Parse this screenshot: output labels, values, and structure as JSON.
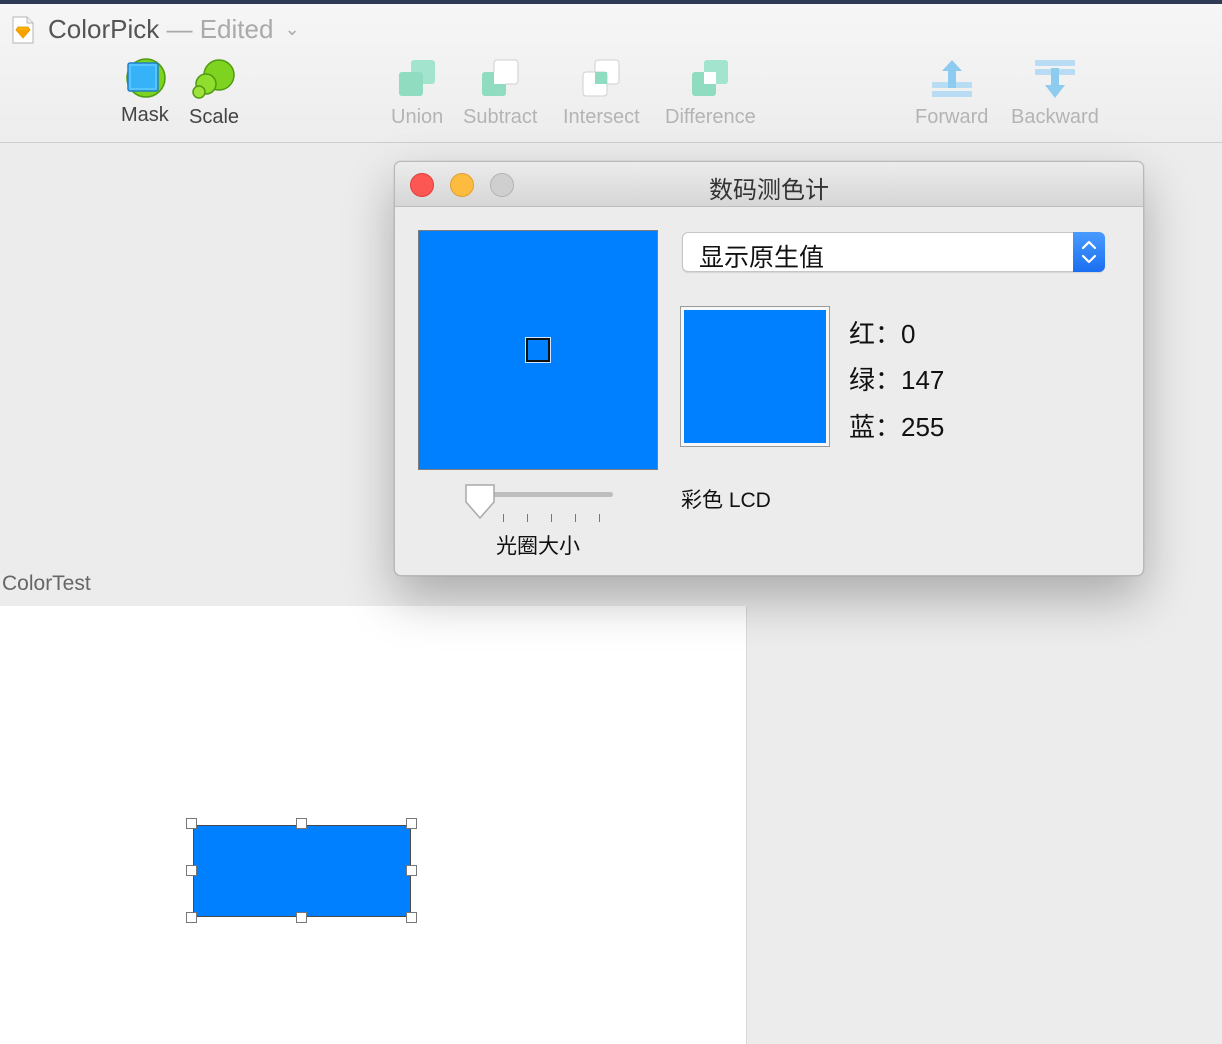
{
  "window": {
    "title": "ColorPick",
    "status": "— Edited"
  },
  "toolbar": {
    "tools": [
      {
        "label": "Mask",
        "icon": "mask-icon",
        "enabled": true
      },
      {
        "label": "Scale",
        "icon": "scale-icon",
        "enabled": true
      },
      {
        "label": "Union",
        "icon": "union-icon",
        "enabled": false
      },
      {
        "label": "Subtract",
        "icon": "subtract-icon",
        "enabled": false
      },
      {
        "label": "Intersect",
        "icon": "intersect-icon",
        "enabled": false
      },
      {
        "label": "Difference",
        "icon": "difference-icon",
        "enabled": false
      },
      {
        "label": "Forward",
        "icon": "forward-icon",
        "enabled": false
      },
      {
        "label": "Backward",
        "icon": "backward-icon",
        "enabled": false
      }
    ]
  },
  "canvas": {
    "artboard_name": "ColorTest",
    "shape_color": "#0080ff"
  },
  "color_meter": {
    "title": "数码测色计",
    "display_mode": "显示原生值",
    "aperture_label": "光圈大小",
    "aperture_size": 0,
    "profile": "彩色 LCD",
    "sample_color": "#0080ff",
    "red_label": "红：",
    "red_value": "0",
    "green_label": "绿：",
    "green_value": "147",
    "blue_label": "蓝：",
    "blue_value": "255"
  },
  "colors": {
    "accent_blue": "#1a6ff0",
    "close": "#fc5753",
    "minimize": "#fdbc40",
    "zoom": "#cfcfcf",
    "tool_disabled": "#9fe0c6"
  }
}
